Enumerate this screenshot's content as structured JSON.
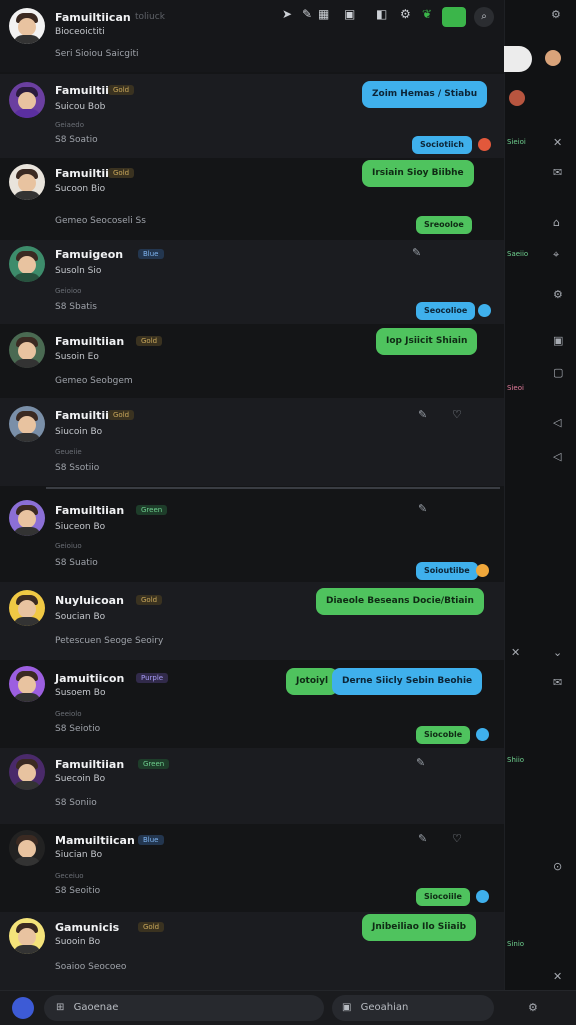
{
  "top": {
    "name": "Famuiltiican",
    "status": "Bioceoictiti",
    "badge": "toliuck",
    "meta": "Seri Sioiou Saicgiti"
  },
  "rows": [
    {
      "name": "Famuiltiican",
      "badge": "Gold",
      "sub": "Suicou Bob",
      "cap": "Geiaedo",
      "meta": "S8 Soatio",
      "reply": "Zoim Hemas / Stiabu",
      "pill": "Sociotiich",
      "alt": true
    },
    {
      "name": "Famuiltiican",
      "badge": "Gold",
      "sub": "Sucoon Bio",
      "meta": "Gemeo Seocoseli Ss",
      "reply": "Irsiain Sioy Biibhe",
      "pill": "Sreooloe",
      "alt": false
    },
    {
      "name": "Famuigeon",
      "badge": "Blue",
      "sub": "Susoln Sio",
      "cap": "Geioioo",
      "meta": "S8 Sbatis",
      "reply": "",
      "pill": "Seocolioe",
      "alt": true
    },
    {
      "name": "Famuiltiian",
      "badge": "Gold",
      "sub": "Susoin Eo",
      "meta": "Gemeo Seobgem",
      "reply": "Iop Jsiicit Shiain",
      "pill": "",
      "alt": false
    },
    {
      "name": "Famuiltiian",
      "badge": "Gold",
      "sub": "Siucoin Bo",
      "cap": "Geueiie",
      "meta": "S8 Ssotiio",
      "reply": "",
      "pill": "",
      "alt": true
    },
    {
      "name": "Famuiltiian",
      "badge": "Green",
      "sub": "Siuceon Bo",
      "cap": "Geioiuo",
      "meta": "S8 Suatio",
      "reply": "",
      "pill": "Soioutiibe",
      "alt": false
    },
    {
      "name": "Nuyluicoan",
      "badge": "Gold",
      "sub": "Soucian Bo",
      "meta": "Petescuen Seoge Seoiry",
      "reply": "Diaeole Beseans Docie/Btiain",
      "pill": "",
      "alt": true
    },
    {
      "name": "Jamuitiicon",
      "badge": "Purple",
      "sub": "Susoem Bo",
      "cap": "Geeiolo",
      "meta": "S8 Seiotio",
      "reply": "Derne Siicly Sebin Beohie",
      "reply2": "Jotoiyl",
      "pill": "Siocoble",
      "alt": false
    },
    {
      "name": "Famuiltiian",
      "badge": "Green",
      "sub": "Suecoin Bo",
      "meta": "S8 Soniio",
      "reply": "",
      "pill": "",
      "alt": true
    },
    {
      "name": "Mamuiltiican",
      "badge": "Blue",
      "sub": "Siucian Bo",
      "cap": "Geceiuo",
      "meta": "S8 Seoitio",
      "reply": "",
      "pill": "Siocoiile",
      "alt": false
    },
    {
      "name": "Gamunicis",
      "badge": "Gold",
      "sub": "Suooin Bo",
      "meta": "Soaioo Seocoeo",
      "reply": "Jnibeiliao Ilo Siiaib",
      "pill": "",
      "alt": true
    }
  ],
  "bottom": {
    "left_placeholder": "Gaoenae",
    "right_placeholder": "Geoahian"
  },
  "colors": {
    "accent_blue": "#3fb0ec",
    "accent_green": "#4fc35e",
    "bg": "#141517"
  }
}
